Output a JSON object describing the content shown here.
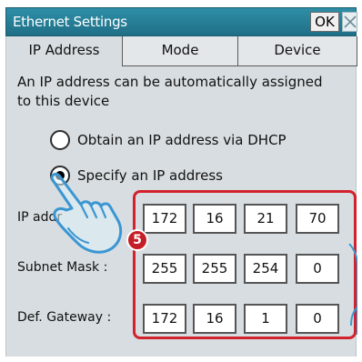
{
  "dialog": {
    "title": "Ethernet Settings",
    "ok_label": "OK",
    "close_icon": "close-icon"
  },
  "tabs": [
    {
      "label": "IP Address",
      "active": true
    },
    {
      "label": "Mode",
      "active": false
    },
    {
      "label": "Device",
      "active": false
    }
  ],
  "description": "An IP address can be automatically assigned to this device",
  "radios": [
    {
      "label": "Obtain an IP address via DHCP",
      "selected": false
    },
    {
      "label": "Specify an IP address",
      "selected": true
    }
  ],
  "fields": {
    "ip_label": "IP addr",
    "subnet_label": "Subnet Mask :",
    "gateway_label": "Def. Gateway :",
    "ip": [
      "172",
      "16",
      "21",
      "70"
    ],
    "subnet": [
      "255",
      "255",
      "254",
      "0"
    ],
    "gateway": [
      "172",
      "16",
      "1",
      "0"
    ]
  },
  "annotation": {
    "step": "5",
    "icon": "hand-pointer-icon",
    "highlight_color": "#d2222d",
    "cursor_color": "#4aa6d8"
  }
}
